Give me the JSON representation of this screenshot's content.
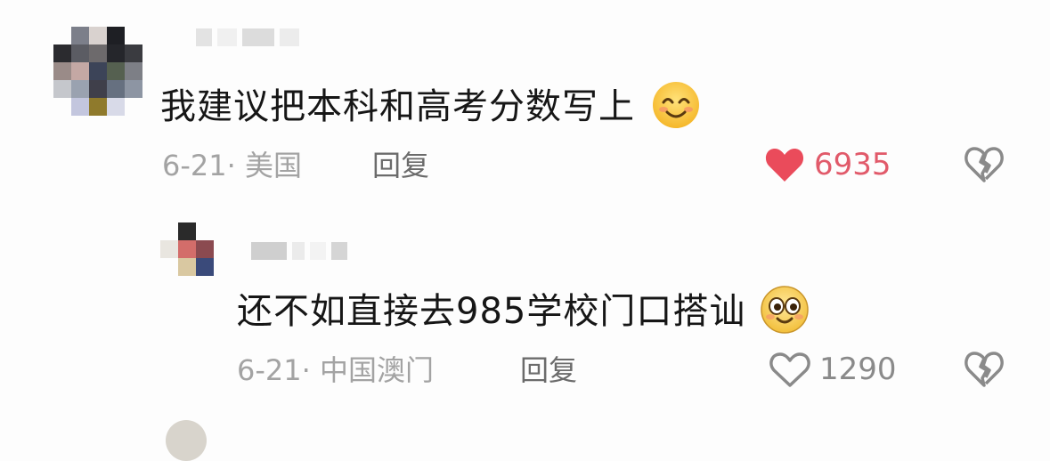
{
  "comments": [
    {
      "text": "我建议把本科和高考分数写上",
      "emoji": "smiling-face-emoji",
      "date": "6-21·",
      "location": "美国",
      "reply_label": "回复",
      "likes": "6935",
      "liked": true
    },
    {
      "text": "还不如直接去985学校门口搭讪",
      "emoji": "grinning-eyes-face-emoji",
      "date": "6-21·",
      "location": "中国澳门",
      "reply_label": "回复",
      "likes": "1290",
      "liked": false
    }
  ],
  "colors": {
    "liked_heart": "#ea4b5b",
    "liked_count": "#e15a6a",
    "meta_gray": "#a3a3a3",
    "reply_gray": "#6b6b6b",
    "text": "#161616"
  },
  "icons": {
    "like": "heart-icon",
    "dislike": "broken-heart-icon"
  }
}
